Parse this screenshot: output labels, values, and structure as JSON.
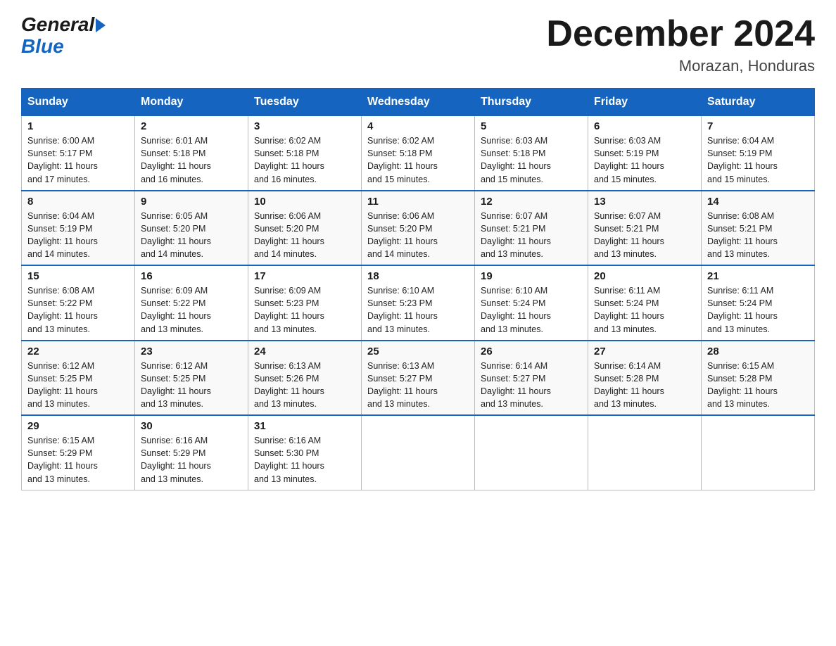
{
  "logo": {
    "text_general": "General",
    "text_blue": "Blue"
  },
  "title": {
    "month_year": "December 2024",
    "location": "Morazan, Honduras"
  },
  "weekdays": [
    "Sunday",
    "Monday",
    "Tuesday",
    "Wednesday",
    "Thursday",
    "Friday",
    "Saturday"
  ],
  "weeks": [
    [
      {
        "day": "1",
        "sunrise": "6:00 AM",
        "sunset": "5:17 PM",
        "daylight": "11 hours and 17 minutes."
      },
      {
        "day": "2",
        "sunrise": "6:01 AM",
        "sunset": "5:18 PM",
        "daylight": "11 hours and 16 minutes."
      },
      {
        "day": "3",
        "sunrise": "6:02 AM",
        "sunset": "5:18 PM",
        "daylight": "11 hours and 16 minutes."
      },
      {
        "day": "4",
        "sunrise": "6:02 AM",
        "sunset": "5:18 PM",
        "daylight": "11 hours and 15 minutes."
      },
      {
        "day": "5",
        "sunrise": "6:03 AM",
        "sunset": "5:18 PM",
        "daylight": "11 hours and 15 minutes."
      },
      {
        "day": "6",
        "sunrise": "6:03 AM",
        "sunset": "5:19 PM",
        "daylight": "11 hours and 15 minutes."
      },
      {
        "day": "7",
        "sunrise": "6:04 AM",
        "sunset": "5:19 PM",
        "daylight": "11 hours and 15 minutes."
      }
    ],
    [
      {
        "day": "8",
        "sunrise": "6:04 AM",
        "sunset": "5:19 PM",
        "daylight": "11 hours and 14 minutes."
      },
      {
        "day": "9",
        "sunrise": "6:05 AM",
        "sunset": "5:20 PM",
        "daylight": "11 hours and 14 minutes."
      },
      {
        "day": "10",
        "sunrise": "6:06 AM",
        "sunset": "5:20 PM",
        "daylight": "11 hours and 14 minutes."
      },
      {
        "day": "11",
        "sunrise": "6:06 AM",
        "sunset": "5:20 PM",
        "daylight": "11 hours and 14 minutes."
      },
      {
        "day": "12",
        "sunrise": "6:07 AM",
        "sunset": "5:21 PM",
        "daylight": "11 hours and 13 minutes."
      },
      {
        "day": "13",
        "sunrise": "6:07 AM",
        "sunset": "5:21 PM",
        "daylight": "11 hours and 13 minutes."
      },
      {
        "day": "14",
        "sunrise": "6:08 AM",
        "sunset": "5:21 PM",
        "daylight": "11 hours and 13 minutes."
      }
    ],
    [
      {
        "day": "15",
        "sunrise": "6:08 AM",
        "sunset": "5:22 PM",
        "daylight": "11 hours and 13 minutes."
      },
      {
        "day": "16",
        "sunrise": "6:09 AM",
        "sunset": "5:22 PM",
        "daylight": "11 hours and 13 minutes."
      },
      {
        "day": "17",
        "sunrise": "6:09 AM",
        "sunset": "5:23 PM",
        "daylight": "11 hours and 13 minutes."
      },
      {
        "day": "18",
        "sunrise": "6:10 AM",
        "sunset": "5:23 PM",
        "daylight": "11 hours and 13 minutes."
      },
      {
        "day": "19",
        "sunrise": "6:10 AM",
        "sunset": "5:24 PM",
        "daylight": "11 hours and 13 minutes."
      },
      {
        "day": "20",
        "sunrise": "6:11 AM",
        "sunset": "5:24 PM",
        "daylight": "11 hours and 13 minutes."
      },
      {
        "day": "21",
        "sunrise": "6:11 AM",
        "sunset": "5:24 PM",
        "daylight": "11 hours and 13 minutes."
      }
    ],
    [
      {
        "day": "22",
        "sunrise": "6:12 AM",
        "sunset": "5:25 PM",
        "daylight": "11 hours and 13 minutes."
      },
      {
        "day": "23",
        "sunrise": "6:12 AM",
        "sunset": "5:25 PM",
        "daylight": "11 hours and 13 minutes."
      },
      {
        "day": "24",
        "sunrise": "6:13 AM",
        "sunset": "5:26 PM",
        "daylight": "11 hours and 13 minutes."
      },
      {
        "day": "25",
        "sunrise": "6:13 AM",
        "sunset": "5:27 PM",
        "daylight": "11 hours and 13 minutes."
      },
      {
        "day": "26",
        "sunrise": "6:14 AM",
        "sunset": "5:27 PM",
        "daylight": "11 hours and 13 minutes."
      },
      {
        "day": "27",
        "sunrise": "6:14 AM",
        "sunset": "5:28 PM",
        "daylight": "11 hours and 13 minutes."
      },
      {
        "day": "28",
        "sunrise": "6:15 AM",
        "sunset": "5:28 PM",
        "daylight": "11 hours and 13 minutes."
      }
    ],
    [
      {
        "day": "29",
        "sunrise": "6:15 AM",
        "sunset": "5:29 PM",
        "daylight": "11 hours and 13 minutes."
      },
      {
        "day": "30",
        "sunrise": "6:16 AM",
        "sunset": "5:29 PM",
        "daylight": "11 hours and 13 minutes."
      },
      {
        "day": "31",
        "sunrise": "6:16 AM",
        "sunset": "5:30 PM",
        "daylight": "11 hours and 13 minutes."
      },
      null,
      null,
      null,
      null
    ]
  ],
  "labels": {
    "sunrise": "Sunrise:",
    "sunset": "Sunset:",
    "daylight": "Daylight:"
  }
}
